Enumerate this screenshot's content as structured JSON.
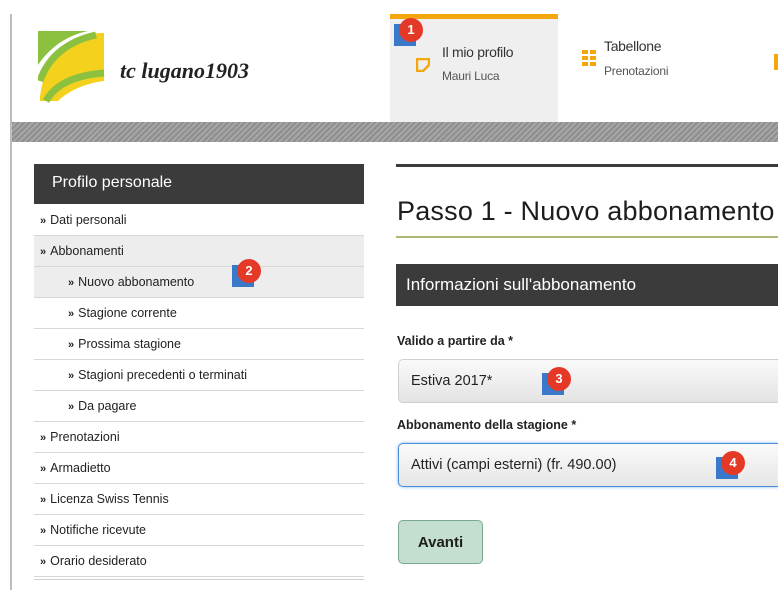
{
  "header": {
    "club_name": "tc lugano1903",
    "tabs": [
      {
        "title": "Il mio profilo",
        "subtitle": "Mauri Luca",
        "icon": "profile-icon",
        "active": true
      },
      {
        "title": "Tabellone",
        "subtitle": "Prenotazioni",
        "icon": "board-icon",
        "active": false
      }
    ]
  },
  "sidebar": {
    "title": "Profilo personale",
    "bullet": "»",
    "items": [
      {
        "label": "Dati personali",
        "level": 1
      },
      {
        "label": "Abbonamenti",
        "level": 1
      },
      {
        "label": "Nuovo abbonamento",
        "level": 2
      },
      {
        "label": "Stagione corrente",
        "level": 2
      },
      {
        "label": "Prossima stagione",
        "level": 2
      },
      {
        "label": "Stagioni precedenti o terminati",
        "level": 2
      },
      {
        "label": "Da pagare",
        "level": 2
      },
      {
        "label": "Prenotazioni",
        "level": 1
      },
      {
        "label": "Armadietto",
        "level": 1
      },
      {
        "label": "Licenza Swiss Tennis",
        "level": 1
      },
      {
        "label": "Notifiche ricevute",
        "level": 1
      },
      {
        "label": "Orario desiderato",
        "level": 1
      }
    ]
  },
  "main": {
    "page_title": "Passo 1 - Nuovo abbonamento",
    "section_title": "Informazioni sull'abbonamento",
    "fields": [
      {
        "label": "Valido a partire da *",
        "value": "Estiva 2017*"
      },
      {
        "label": "Abbonamento della stagione *",
        "value": "Attivi (campi esterni) (fr. 490.00)"
      }
    ],
    "next_button": "Avanti"
  },
  "markers": [
    "1",
    "2",
    "3",
    "4"
  ],
  "colors": {
    "accent": "#f4a70c",
    "dark_bar": "#3b3b3b",
    "button_green": "#c4dfcf",
    "marker_red": "#e53928",
    "marker_blue": "#3a78c9"
  }
}
